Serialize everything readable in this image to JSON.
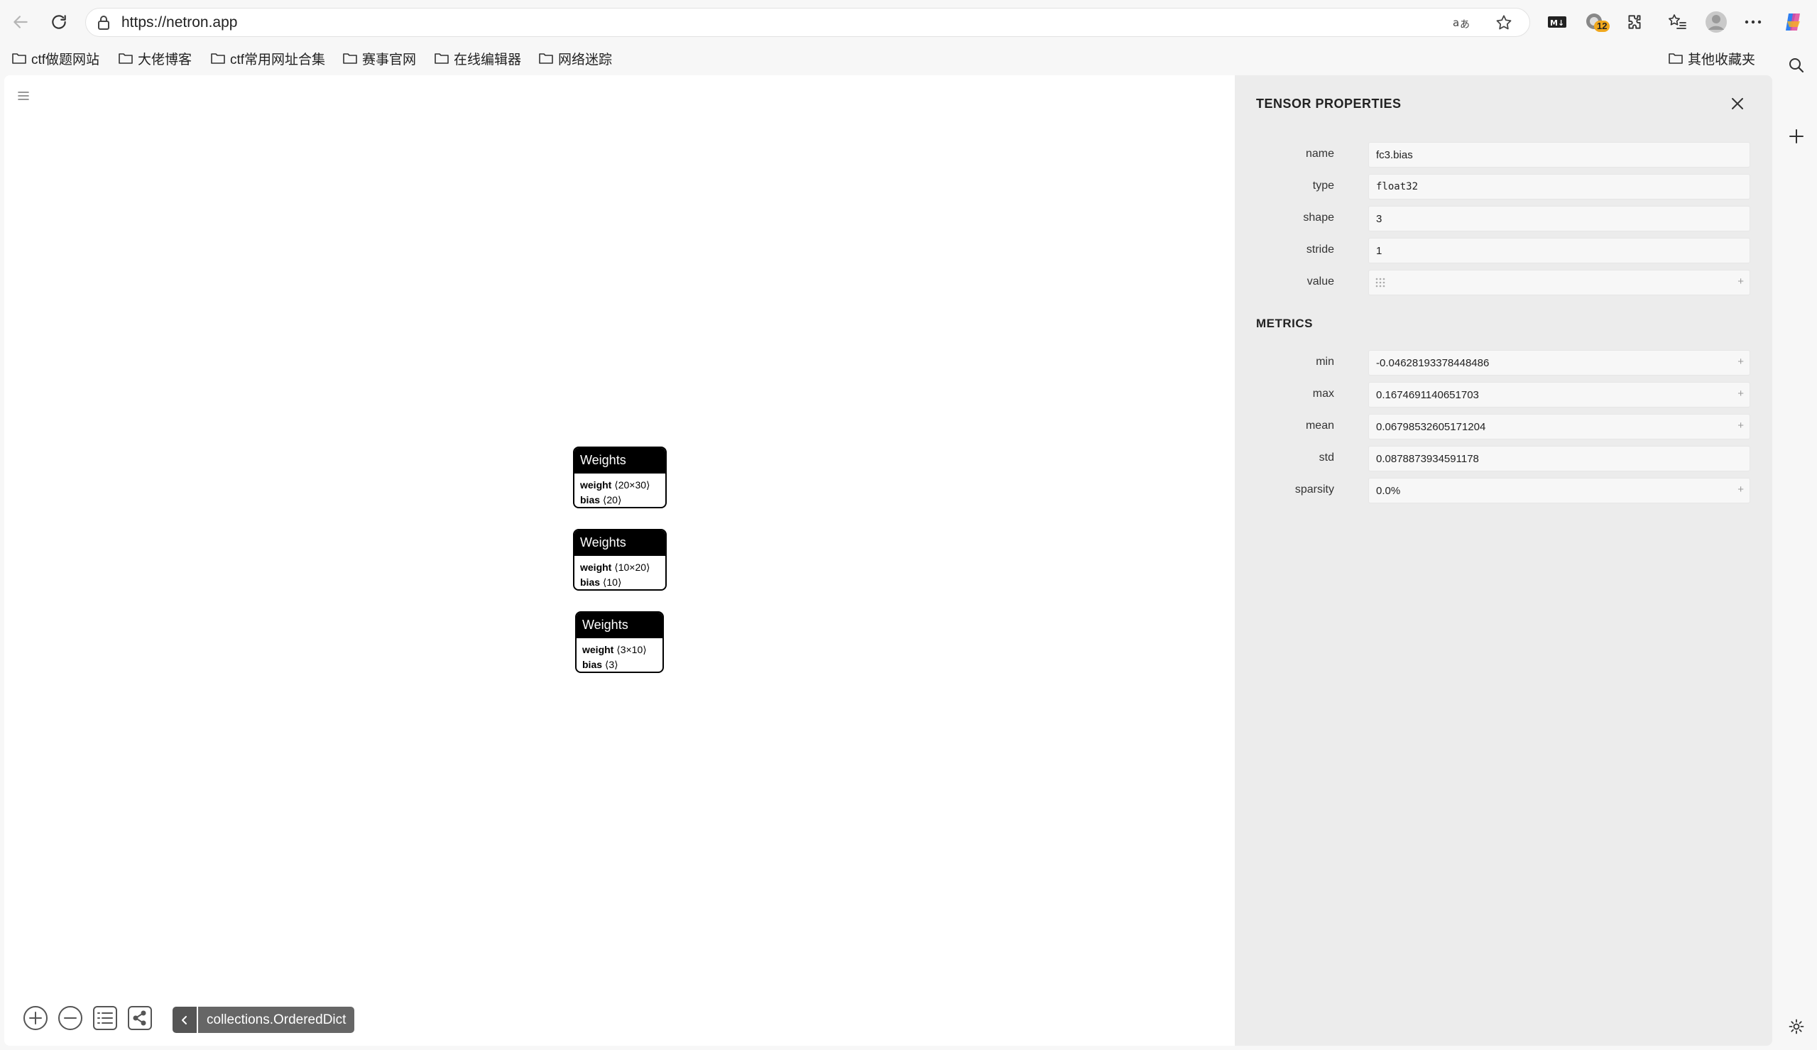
{
  "browser": {
    "url": "https://netron.app",
    "extension_badge": "12",
    "bookmarks": [
      "ctf做题网站",
      "大佬博客",
      "ctf常用网址合集",
      "赛事官网",
      "在线编辑器",
      "网络迷踪"
    ],
    "other_bookmarks": "其他收藏夹"
  },
  "graph": {
    "nodes": [
      {
        "title": "Weights",
        "rows": [
          {
            "name": "weight",
            "shape": "⟨20×30⟩"
          },
          {
            "name": "bias",
            "shape": "⟨20⟩"
          }
        ]
      },
      {
        "title": "Weights",
        "rows": [
          {
            "name": "weight",
            "shape": "⟨10×20⟩"
          },
          {
            "name": "bias",
            "shape": "⟨10⟩"
          }
        ]
      },
      {
        "title": "Weights",
        "rows": [
          {
            "name": "weight",
            "shape": "⟨3×10⟩"
          },
          {
            "name": "bias",
            "shape": "⟨3⟩"
          }
        ]
      }
    ],
    "breadcrumb": "collections.OrderedDict"
  },
  "panel": {
    "title": "TENSOR PROPERTIES",
    "properties": [
      {
        "label": "name",
        "value": "fc3.bias"
      },
      {
        "label": "type",
        "value": "float32"
      },
      {
        "label": "shape",
        "value": "3"
      },
      {
        "label": "stride",
        "value": "1"
      },
      {
        "label": "value",
        "value": ""
      }
    ],
    "metrics_title": "METRICS",
    "metrics": [
      {
        "label": "min",
        "value": "-0.04628193378448486"
      },
      {
        "label": "max",
        "value": "0.1674691140651703"
      },
      {
        "label": "mean",
        "value": "0.06798532605171204"
      },
      {
        "label": "std",
        "value": "0.0878873934591178"
      },
      {
        "label": "sparsity",
        "value": "0.0%"
      }
    ],
    "expand_symbol": "+"
  }
}
